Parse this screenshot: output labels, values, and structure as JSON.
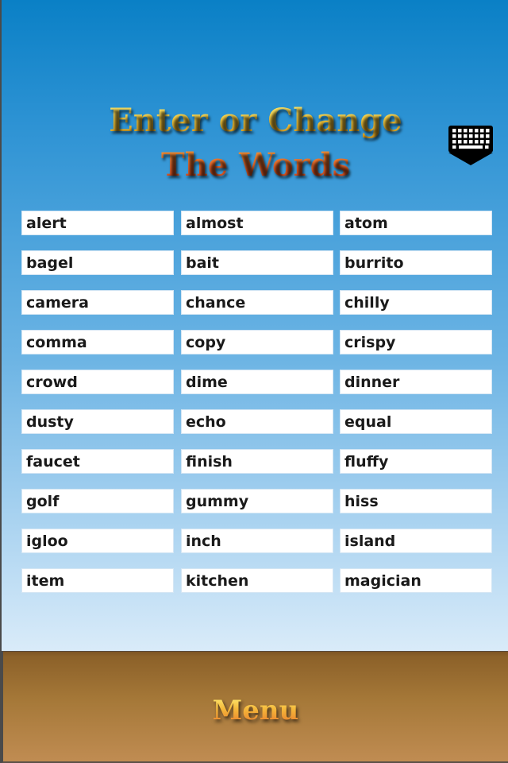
{
  "header": {
    "title_line1": "Enter or Change",
    "title_line2": "The Words",
    "title_colors": {
      "line1": "#f2c43a",
      "line2": "#e8642a"
    }
  },
  "keyboard_button": {
    "icon": "keyboard-hide-icon"
  },
  "words": [
    [
      "alert",
      "almost",
      "atom"
    ],
    [
      "bagel",
      "bait",
      "burrito"
    ],
    [
      "camera",
      "chance",
      "chilly"
    ],
    [
      "comma",
      "copy",
      "crispy"
    ],
    [
      "crowd",
      "dime",
      "dinner"
    ],
    [
      "dusty",
      "echo",
      "equal"
    ],
    [
      "faucet",
      "finish",
      "fluffy"
    ],
    [
      "golf",
      "gummy",
      "hiss"
    ],
    [
      "igloo",
      "inch",
      "island"
    ],
    [
      "item",
      "kitchen",
      "magician"
    ]
  ],
  "footer": {
    "menu_label": "Menu"
  },
  "colors": {
    "background_top": "#0a80c6",
    "background_bottom": "#d9ebf9",
    "footer_top": "#8c6129",
    "footer_bottom": "#c08c52"
  }
}
